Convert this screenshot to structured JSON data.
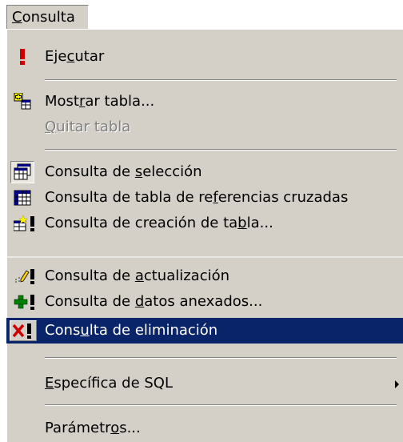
{
  "menubar": {
    "title": "Consulta"
  },
  "menu": {
    "items": [
      {
        "pre": "Eje",
        "acc": "c",
        "post": "utar",
        "icon": "exclamation-icon"
      },
      {
        "pre": "Most",
        "acc": "r",
        "post": "ar tabla...",
        "icon": "show-table-icon"
      },
      {
        "pre": "",
        "acc": "Q",
        "post": "uitar tabla",
        "icon": "none",
        "disabled": true
      },
      {
        "pre": "Consulta de ",
        "acc": "s",
        "post": "elección",
        "icon": "select-query-icon"
      },
      {
        "pre": "Consulta de tabla de re",
        "acc": "f",
        "post": "erencias cruzadas",
        "icon": "crosstab-query-icon"
      },
      {
        "pre": "Consulta de creación de ta",
        "acc": "b",
        "post": "la...",
        "icon": "make-table-query-icon"
      },
      {
        "pre": "Consulta de ",
        "acc": "a",
        "post": "ctualización",
        "icon": "update-query-icon"
      },
      {
        "pre": "Consulta de ",
        "acc": "d",
        "post": "atos anexados...",
        "icon": "append-query-icon"
      },
      {
        "pre": "Cons",
        "acc": "u",
        "post": "lta de eliminación",
        "icon": "delete-query-icon",
        "highlighted": true
      },
      {
        "pre": "",
        "acc": "E",
        "post": "specífica de SQL",
        "icon": "none",
        "submenu": true
      },
      {
        "pre": "Parámetr",
        "acc": "o",
        "post": "s...",
        "icon": "none"
      }
    ]
  },
  "colors": {
    "menu_bg": "#d4d0c8",
    "highlight": "#0a246a",
    "icon_red": "#cc0000",
    "icon_green": "#008000"
  }
}
